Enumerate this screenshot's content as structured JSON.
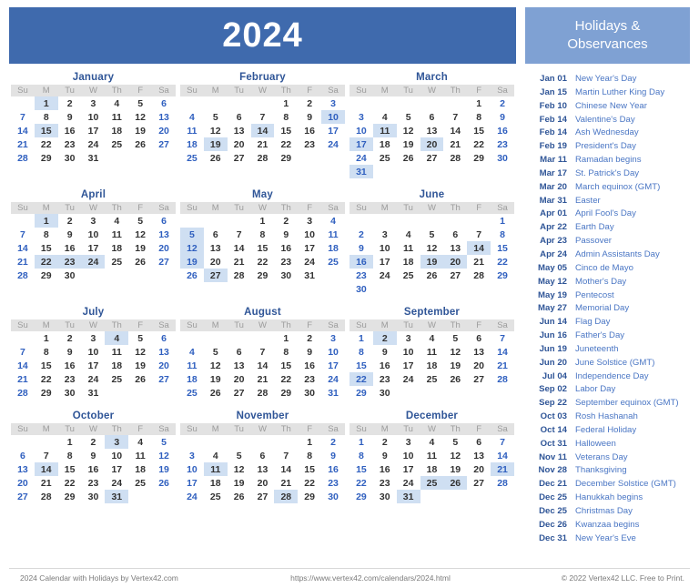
{
  "banner": {
    "year": "2024",
    "holidays_title": "Holidays &\nObservances"
  },
  "colors": {
    "year_banner_bg": "#3f6aad",
    "holidays_banner_bg": "#7fa1d3",
    "month_name": "#2f5597",
    "weekend_text": "#2f5fbf",
    "weekday_text": "#333333",
    "highlight_bg": "#cfdff2",
    "dow_header_bg": "#e2e2e2",
    "dow_header_text": "#9c9c9c",
    "holiday_date": "#2f5597",
    "holiday_name": "#4a76c4",
    "footer_text": "#7a7a7a"
  },
  "dow": [
    "Su",
    "M",
    "Tu",
    "W",
    "Th",
    "F",
    "Sa"
  ],
  "months": [
    {
      "name": "January",
      "start": 1,
      "days": 31,
      "highlights": [
        1,
        15
      ]
    },
    {
      "name": "February",
      "start": 4,
      "days": 29,
      "highlights": [
        10,
        14,
        19
      ]
    },
    {
      "name": "March",
      "start": 5,
      "days": 31,
      "highlights": [
        11,
        17,
        20,
        31
      ]
    },
    {
      "name": "April",
      "start": 1,
      "days": 30,
      "highlights": [
        1,
        22,
        23,
        24
      ]
    },
    {
      "name": "May",
      "start": 3,
      "days": 31,
      "highlights": [
        5,
        12,
        19,
        27
      ]
    },
    {
      "name": "June",
      "start": 6,
      "days": 30,
      "highlights": [
        14,
        16,
        19,
        20
      ]
    },
    {
      "name": "July",
      "start": 1,
      "days": 31,
      "highlights": [
        4
      ]
    },
    {
      "name": "August",
      "start": 4,
      "days": 31,
      "highlights": []
    },
    {
      "name": "September",
      "start": 0,
      "days": 30,
      "highlights": [
        2,
        22
      ]
    },
    {
      "name": "October",
      "start": 2,
      "days": 31,
      "highlights": [
        3,
        14,
        31
      ]
    },
    {
      "name": "November",
      "start": 5,
      "days": 30,
      "highlights": [
        11,
        28
      ]
    },
    {
      "name": "December",
      "start": 0,
      "days": 31,
      "highlights": [
        21,
        25,
        26,
        31
      ]
    }
  ],
  "holidays": [
    {
      "date": "Jan 01",
      "name": "New Year's Day"
    },
    {
      "date": "Jan 15",
      "name": "Martin Luther King Day"
    },
    {
      "date": "Feb 10",
      "name": "Chinese New Year"
    },
    {
      "date": "Feb 14",
      "name": "Valentine's Day"
    },
    {
      "date": "Feb 14",
      "name": "Ash Wednesday"
    },
    {
      "date": "Feb 19",
      "name": "President's Day"
    },
    {
      "date": "Mar 11",
      "name": "Ramadan begins"
    },
    {
      "date": "Mar 17",
      "name": "St. Patrick's Day"
    },
    {
      "date": "Mar 20",
      "name": "March equinox (GMT)"
    },
    {
      "date": "Mar 31",
      "name": "Easter"
    },
    {
      "date": "Apr 01",
      "name": "April Fool's Day"
    },
    {
      "date": "Apr 22",
      "name": "Earth Day"
    },
    {
      "date": "Apr 23",
      "name": "Passover"
    },
    {
      "date": "Apr 24",
      "name": "Admin Assistants Day"
    },
    {
      "date": "May 05",
      "name": "Cinco de Mayo"
    },
    {
      "date": "May 12",
      "name": "Mother's Day"
    },
    {
      "date": "May 19",
      "name": "Pentecost"
    },
    {
      "date": "May 27",
      "name": "Memorial Day"
    },
    {
      "date": "Jun 14",
      "name": "Flag Day"
    },
    {
      "date": "Jun 16",
      "name": "Father's Day"
    },
    {
      "date": "Jun 19",
      "name": "Juneteenth"
    },
    {
      "date": "Jun 20",
      "name": "June Solstice (GMT)"
    },
    {
      "date": "Jul 04",
      "name": "Independence Day"
    },
    {
      "date": "Sep 02",
      "name": "Labor Day"
    },
    {
      "date": "Sep 22",
      "name": "September equinox (GMT)"
    },
    {
      "date": "Oct 03",
      "name": "Rosh Hashanah"
    },
    {
      "date": "Oct 14",
      "name": "Federal Holiday"
    },
    {
      "date": "Oct 31",
      "name": "Halloween"
    },
    {
      "date": "Nov 11",
      "name": "Veterans Day"
    },
    {
      "date": "Nov 28",
      "name": "Thanksgiving"
    },
    {
      "date": "Dec 21",
      "name": "December Solstice (GMT)"
    },
    {
      "date": "Dec 25",
      "name": "Hanukkah begins"
    },
    {
      "date": "Dec 25",
      "name": "Christmas Day"
    },
    {
      "date": "Dec 26",
      "name": "Kwanzaa begins"
    },
    {
      "date": "Dec 31",
      "name": "New Year's Eve"
    }
  ],
  "footer": {
    "left": "2024 Calendar with Holidays by Vertex42.com",
    "middle": "https://www.vertex42.com/calendars/2024.html",
    "right": "© 2022 Vertex42 LLC. Free to Print."
  }
}
